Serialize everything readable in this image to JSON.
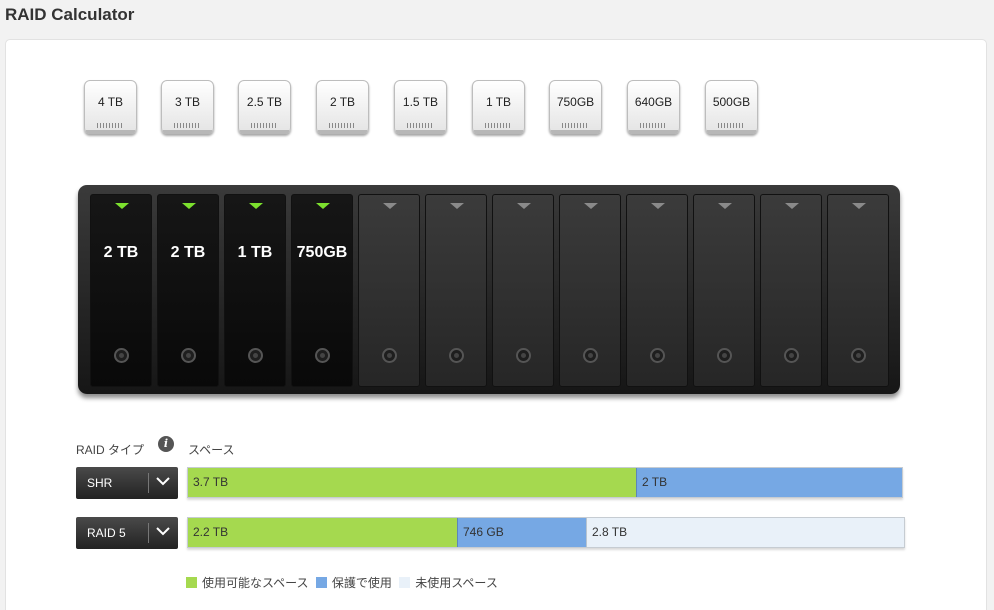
{
  "title": "RAID Calculator",
  "disk_palette": [
    "4 TB",
    "3 TB",
    "2.5 TB",
    "2 TB",
    "1.5 TB",
    "1 TB",
    "750GB",
    "640GB",
    "500GB"
  ],
  "bays": [
    "2 TB",
    "2 TB",
    "1 TB",
    "750GB",
    "",
    "",
    "",
    "",
    "",
    "",
    "",
    ""
  ],
  "labels": {
    "raid_type": "RAID タイプ",
    "info_icon": "i",
    "space": "スペース"
  },
  "rows": [
    {
      "raid": "SHR",
      "usable": "3.7 TB",
      "protection": "2 TB",
      "unused": "",
      "usable_fraction": 0.627,
      "protection_fraction": 0.373,
      "unused_fraction": 0
    },
    {
      "raid": "RAID 5",
      "usable": "2.2 TB",
      "protection": "746 GB",
      "unused": "2.8 TB",
      "usable_fraction": 0.373,
      "protection_fraction": 0.18,
      "unused_fraction": 0.447
    }
  ],
  "legend": {
    "usable": "使用可能なスペース",
    "protection": "保護で使用",
    "unused": "未使用スペース"
  },
  "colors": {
    "usable": "#a5d94f",
    "protection": "#76a8e4",
    "unused": "#e9f1f9",
    "bay_led_filled": "#7ce02e"
  }
}
